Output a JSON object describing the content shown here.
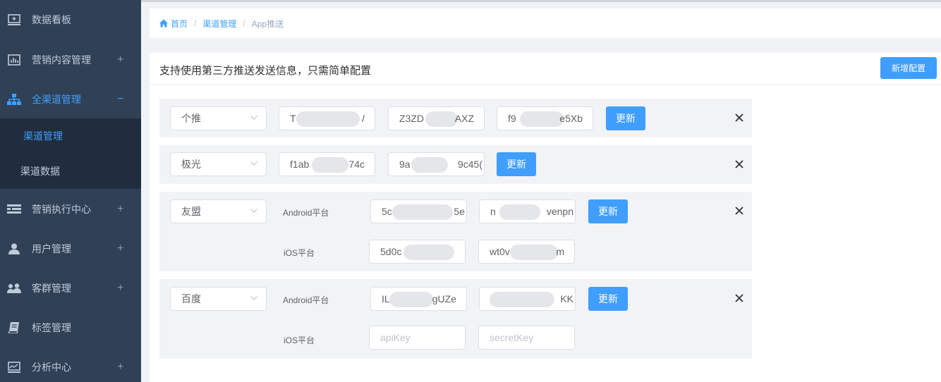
{
  "sidebar": {
    "items": [
      {
        "label": "数据看板",
        "icon": "monitor-icon",
        "expand": ""
      },
      {
        "label": "营销内容管理",
        "icon": "bar-chart-icon",
        "expand": "+"
      },
      {
        "label": "全渠道管理",
        "icon": "sitemap-icon",
        "expand": "−"
      },
      {
        "label": "营销执行中心",
        "icon": "list-icon",
        "expand": "+"
      },
      {
        "label": "用户管理",
        "icon": "user-icon",
        "expand": "+"
      },
      {
        "label": "客群管理",
        "icon": "users-icon",
        "expand": "+"
      },
      {
        "label": "标签管理",
        "icon": "book-icon",
        "expand": ""
      },
      {
        "label": "分析中心",
        "icon": "analytics-icon",
        "expand": "+"
      }
    ],
    "submenu": [
      {
        "label": "渠道管理"
      },
      {
        "label": "渠道数据"
      }
    ]
  },
  "breadcrumb": {
    "home": "首页",
    "parent": "渠道管理",
    "current": "App推送"
  },
  "card": {
    "title": "支持使用第三方推送发送信息，只需简单配置",
    "add_button": "新增配置"
  },
  "update_label": "更新",
  "rows": [
    {
      "provider": "个推",
      "fields": [
        "T",
        "Z3ZD",
        "f9"
      ],
      "tails": [
        "/",
        "AXZ",
        "e5Xb"
      ]
    },
    {
      "provider": "极光",
      "fields": [
        "f1ab",
        "9a"
      ],
      "tails": [
        "74c",
        "9c45("
      ]
    },
    {
      "provider": "友盟",
      "android_label": "Android平台",
      "ios_label": "iOS平台",
      "android": [
        "5c",
        "n"
      ],
      "android_tails": [
        "5e",
        "venpn"
      ],
      "ios": [
        "5d0c",
        "wt0v"
      ],
      "ios_tails": [
        "",
        "m"
      ]
    },
    {
      "provider": "百度",
      "android_label": "Android平台",
      "ios_label": "iOS平台",
      "android": [
        "IL",
        ""
      ],
      "android_tails": [
        "gUZe",
        "KK"
      ],
      "ios_placeholders": [
        "apiKey",
        "secretKey"
      ]
    }
  ]
}
